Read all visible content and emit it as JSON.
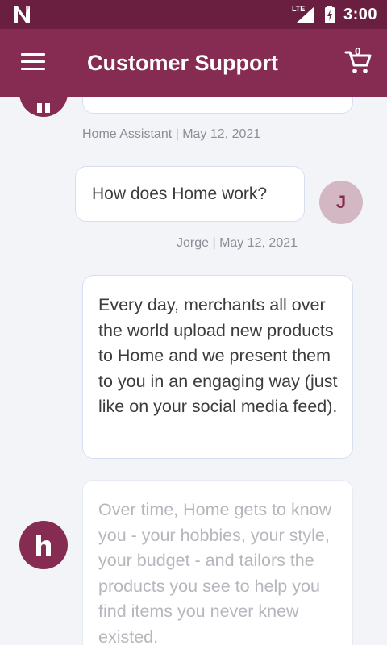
{
  "status_bar": {
    "time": "3:00",
    "network": "LTE",
    "icons": [
      "notification-n-icon",
      "signal-icon",
      "battery-charging-icon"
    ]
  },
  "app_bar": {
    "title": "Customer Support",
    "cart_count": "0",
    "icons": [
      "menu-icon",
      "cart-icon"
    ],
    "color": "#862b51",
    "status_color": "#6a1e40"
  },
  "messages": [
    {
      "sender": "Home Assistant",
      "meta": "Home Assistant | May 12, 2021",
      "text": ""
    },
    {
      "sender": "Jorge",
      "avatar_letter": "J",
      "meta": "Jorge | May 12, 2021",
      "text": "How does Home work?"
    },
    {
      "sender": "Home Assistant",
      "text": "Every day, merchants all over the world upload new products to Home and we present them to you in an engaging way (just like on your social media feed)."
    },
    {
      "sender": "Home Assistant",
      "avatar_letter": "h",
      "text": "Over time, Home gets to know you - your hobbies, your style, your budget - and tailors the products you see to help you find items you never knew existed."
    }
  ]
}
